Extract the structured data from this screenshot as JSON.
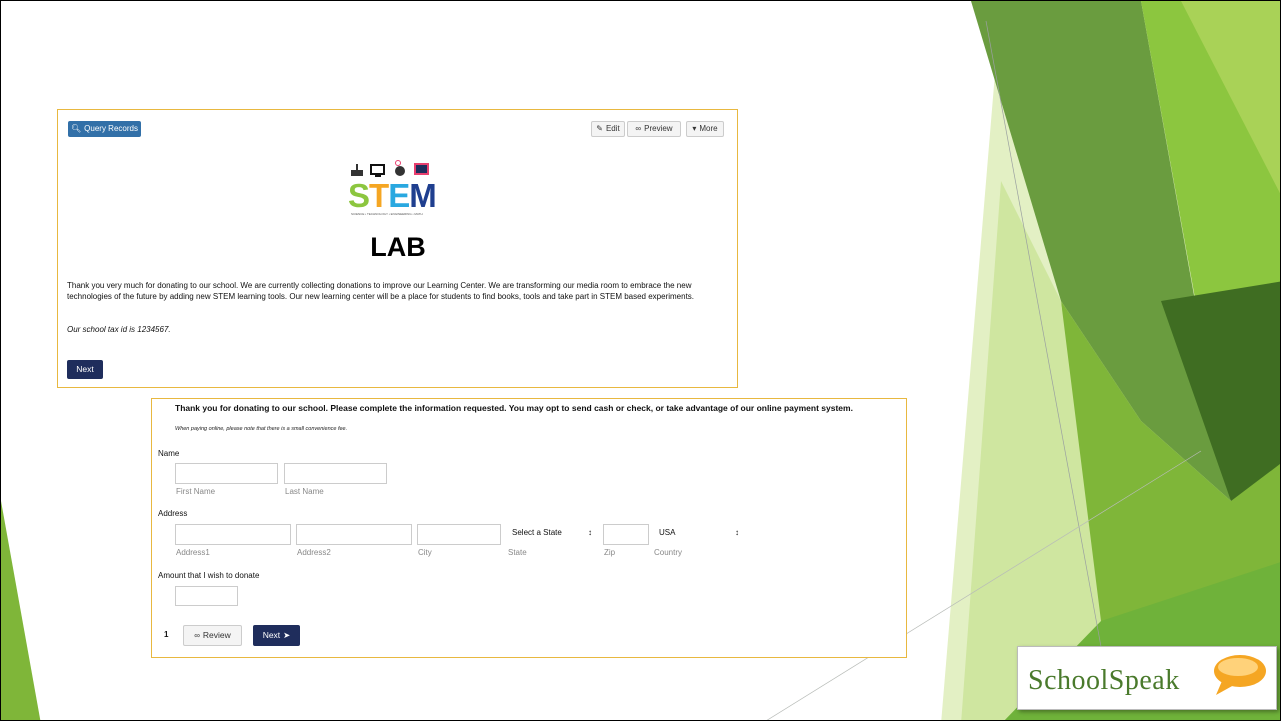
{
  "toolbar": {
    "query_label": "Query Records",
    "edit_label": "Edit",
    "preview_label": "Preview",
    "more_label": "More"
  },
  "banner": {
    "stem_word": "STEM",
    "stem_tagline": "SCIENCE • TECHNOLOGY • ENGINEERING • MATH",
    "lab_word": "LAB"
  },
  "intro": {
    "paragraph": "Thank you very much for donating to our school. We are currently collecting donations to improve our Learning Center. We are transforming our media room to embrace the new technologies of the future by adding new STEM learning tools. Our new learning center will be a place for students to find books, tools and take part in STEM based experiments.",
    "tax_id": "Our school tax id is 1234567.",
    "next_label": "Next"
  },
  "form": {
    "heading": "Thank you for donating to our school. Please complete the information requested. You may opt to send cash or check, or take advantage of our online payment system.",
    "note": "When paying online, please note that there is a small convenience fee.",
    "name_label": "Name",
    "first_name": {
      "value": "",
      "sublabel": "First Name"
    },
    "last_name": {
      "value": "",
      "sublabel": "Last Name"
    },
    "address_label": "Address",
    "address1": {
      "value": "",
      "sublabel": "Address1"
    },
    "address2": {
      "value": "",
      "sublabel": "Address2"
    },
    "city": {
      "value": "",
      "sublabel": "City"
    },
    "state": {
      "value": "Select a State",
      "sublabel": "State"
    },
    "zip": {
      "value": "",
      "sublabel": "Zip"
    },
    "country": {
      "value": "USA",
      "sublabel": "Country"
    },
    "amount_label": "Amount that I wish to donate",
    "amount": {
      "value": ""
    },
    "page_number": "1",
    "review_label": "Review",
    "next_label": "Next"
  },
  "brand": {
    "name": "SchoolSpeak",
    "accent": "#f5a623"
  }
}
